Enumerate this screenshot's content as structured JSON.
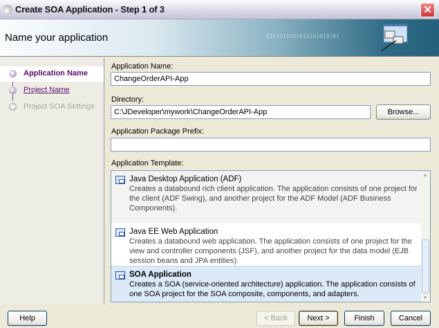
{
  "window": {
    "title": "Create SOA Application - Step 1 of 3",
    "close_label": "✕"
  },
  "banner": {
    "heading": "Name your application",
    "binary_text": "0101010101010101010101"
  },
  "steps": [
    {
      "label": "Application Name",
      "state": "current"
    },
    {
      "label": "Project Name",
      "state": "visited"
    },
    {
      "label": "Project SOA Settings",
      "state": "disabled"
    }
  ],
  "form": {
    "app_name": {
      "label": "Application Name:",
      "value": "ChangeOrderAPI-App"
    },
    "directory": {
      "label": "Directory:",
      "value": "C:\\JDeveloper\\mywork\\ChangeOrderAPI-App",
      "browse": "Browse..."
    },
    "package_prefix": {
      "label": "Application Package Prefix:",
      "value": ""
    },
    "template": {
      "label": "Application Template:",
      "items": [
        {
          "title": "Java Desktop Application (ADF)",
          "desc": "Creates a databound rich client application. The application consists of one project for the client (ADF Swing), and another project for the ADF Model (ADF Business Components)."
        },
        {
          "title": "Java EE Web Application",
          "desc": "Creates a databound web application. The application consists of one project for the view and controller components (JSF), and another project for the data model (EJB session beans and JPA entities)."
        },
        {
          "title": "SOA Application",
          "desc": "Creates a SOA (service-oriented architecture) application. The application consists of one SOA project for the SOA composite, components, and adapters.",
          "selected": true
        }
      ]
    }
  },
  "buttons": {
    "help": "Help",
    "back": "< Back",
    "next": "Next >",
    "finish": "Finish",
    "cancel": "Cancel"
  },
  "colors": {
    "selection": "#dce9f7",
    "step_accent": "#5a0a6e"
  }
}
